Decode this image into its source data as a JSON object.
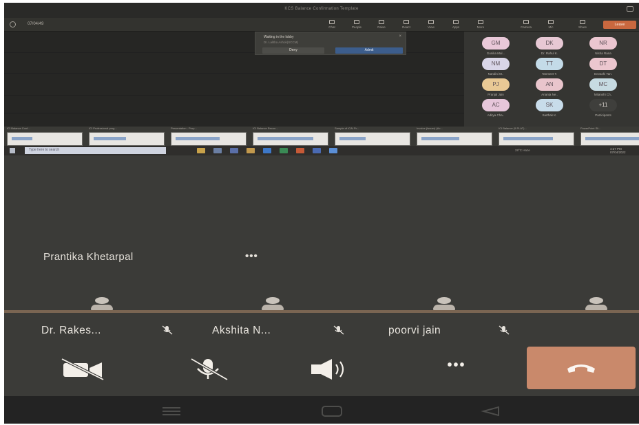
{
  "shared_window": {
    "title": "KCS Balance Confirmation Template",
    "back_label": "07/04/49",
    "toolbar": [
      "Chat",
      "People",
      "Raise",
      "React",
      "View",
      "Apps",
      "More"
    ],
    "toolbar_right": [
      "Camera",
      "Mic",
      "Share",
      "Leave"
    ]
  },
  "popup": {
    "text": "Waiting in the lobby",
    "sub": "Dr. Lalitha Ashok(SCCM)",
    "deny_label": "Deny",
    "admit_label": "Admit"
  },
  "roster": [
    {
      "initials": "GM",
      "name": "Gunika Mal...",
      "color": "#e9c8d8"
    },
    {
      "initials": "DK",
      "name": "Dr. Rahul K.",
      "color": "#e7c8d4"
    },
    {
      "initials": "NR",
      "name": "Nisha Rana",
      "color": "#ebc6d0"
    },
    {
      "initials": "NM",
      "name": "Nandini M..",
      "color": "#d9d6e8"
    },
    {
      "initials": "TT",
      "name": "Tanmeet T.",
      "color": "#c4dbe8"
    },
    {
      "initials": "DT",
      "name": "Devashi Tan.",
      "color": "#ecc7cf"
    },
    {
      "initials": "PJ",
      "name": "Pranjal Jain",
      "color": "#e9c995"
    },
    {
      "initials": "AN",
      "name": "Ananta Ne..",
      "color": "#e9c5cc"
    },
    {
      "initials": "MC",
      "name": "Mitanshi Ch..",
      "color": "#c7dbe2"
    },
    {
      "initials": "AC",
      "name": "Aditya Cha..",
      "color": "#e6c6da"
    },
    {
      "initials": "SK",
      "name": "Sarthak K.",
      "color": "#c8dcea"
    },
    {
      "initials": "+11",
      "name": "Participants",
      "color": "#3f3f3c"
    }
  ],
  "thumbnails": [
    "ICI Balance Conf...",
    "ICI Professional prog...",
    "Presentation - Prop...",
    "ICI Balance Recon...",
    "Sample of ICAI Pr...",
    "Invoice (Issuer) (Ac...",
    "ICI Balance (5 PLAT)...",
    "PowerPoint Sli..."
  ],
  "win_taskbar": {
    "search_placeholder": "Type here to search",
    "weather": "28°C Haze",
    "time": "4:27 PM",
    "date": "07/04/2022"
  },
  "presenter": {
    "name": "Prantika Khetarpal",
    "more": "•••"
  },
  "tiles": [
    {
      "name": "Dr. Rakes..."
    },
    {
      "name": "Akshita N..."
    },
    {
      "name": "poorvi jain"
    }
  ],
  "controls": {
    "camera": "camera-off",
    "mic": "mic-off",
    "speaker": "speaker",
    "more": "•••",
    "end": "hang-up"
  },
  "colors": {
    "background": "#3b3b38",
    "end_call": "#c9896b",
    "divider": "#7a6552"
  }
}
